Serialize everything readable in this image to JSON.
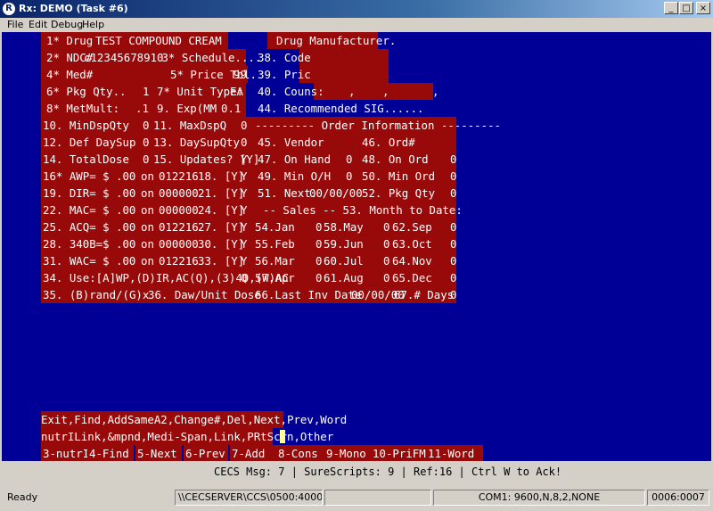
{
  "window": {
    "title": "Rx: DEMO  (Task #6)",
    "icon": "app-icon"
  },
  "menu": [
    "File",
    "Edit",
    "Debug",
    "Help"
  ],
  "terminal": {
    "rows": [
      [
        "1* Drug ",
        "TEST COMPOUND CREAM",
        "",
        "Drug Manufacturer.",
        ""
      ],
      [
        "2* NDC# ",
        "c12345678910",
        " 3* Schedule....",
        "",
        "38. Code",
        ""
      ],
      [
        "4* Med#",
        "",
        "5* Price Tbl.",
        "99",
        "39. Pric",
        ""
      ],
      [
        "6* Pkg Qty..",
        "1",
        "7* Unit Type:",
        "EA",
        "40. Couns:",
        ",",
        ",",
        ","
      ],
      [
        "8* MetMult:",
        ".1",
        "9. Exp(MM",
        "0.1",
        "44. Recommended SIG......"
      ],
      [
        "10. MinDspQty",
        "0",
        "11. MaxDspQ",
        "0",
        "--------- Order Information ---------"
      ],
      [
        "12. Def DaySup",
        "0",
        "13. DaySupQty",
        "0",
        "45. Vendor",
        "46. Ord#"
      ],
      [
        "14. TotalDose",
        "0",
        "15. Updates? [Y]",
        "Y",
        "47. On Hand",
        "0",
        "48. On Ord",
        "0"
      ],
      [
        "16* AWP= $",
        ".00",
        "on",
        "012216",
        "18. [Y]",
        "Y",
        "49. Min O/H",
        "0",
        "50. Min Ord",
        "0"
      ],
      [
        "19. DIR= $",
        ".00",
        "on",
        "000000",
        "21. [Y]",
        "Y",
        "51. Next.",
        "00/00/00",
        "52. Pkg Qty",
        "0"
      ],
      [
        "22. MAC= $",
        ".00",
        "on",
        "000000",
        "24. [Y]",
        "Y",
        "-- Sales -- 53. Month to Date:"
      ],
      [
        "25. ACQ= $",
        ".00",
        "on",
        "012216",
        "27. [Y]",
        "Y",
        "54.Jan",
        "0",
        "58.May",
        "0",
        "62.Sep",
        "0"
      ],
      [
        "28. 340B=$",
        ".00",
        "on",
        "000000",
        "30. [Y]",
        "Y",
        "55.Feb",
        "0",
        "59.Jun",
        "0",
        "63.Oct",
        "0"
      ],
      [
        "31. WAC= $",
        ".00",
        "on",
        "012216",
        "33. [Y]",
        "Y",
        "56.Mar",
        "0",
        "60.Jul",
        "0",
        "64.Nov",
        "0"
      ],
      [
        "34. Use:[A]WP,(D)IR,AC(Q),(3)40,(W)AC",
        "Q",
        "57.Apr",
        "0",
        "61.Aug",
        "0",
        "65.Dec",
        "0"
      ],
      [
        "35. (B)rand/(G)x",
        "36. Daw/Unit Dose",
        "66.Last Inv Date",
        "00/00/00",
        "67.# Days",
        "0"
      ]
    ],
    "commands1": "Exit,Find,AddSameA2,Change#,Del,Next,Prev,Word",
    "commands2": "nutrILink,&mpnd,Medi-Span,Link,PRtScrn,Other",
    "fkeys": [
      "3-nutrI",
      "4-Find",
      "5-Next",
      "6-Prev",
      "7-Add",
      "8-Cons",
      "9-Mono",
      "10-PriFM",
      "11-Word"
    ]
  },
  "message_line": "CECS Msg: 7 | SureScripts: 9 | Ref:16 | Ctrl W to Ack!",
  "status": {
    "ready": "Ready",
    "server": "\\\\CECSERVER\\CCS\\0500:40003",
    "port": "COM1: 9600,N,8,2,NONE",
    "position": "0006:0007"
  },
  "colors": {
    "screen_bg": "#000096",
    "field_bg": "#980a0a",
    "text": "#ffffff"
  }
}
